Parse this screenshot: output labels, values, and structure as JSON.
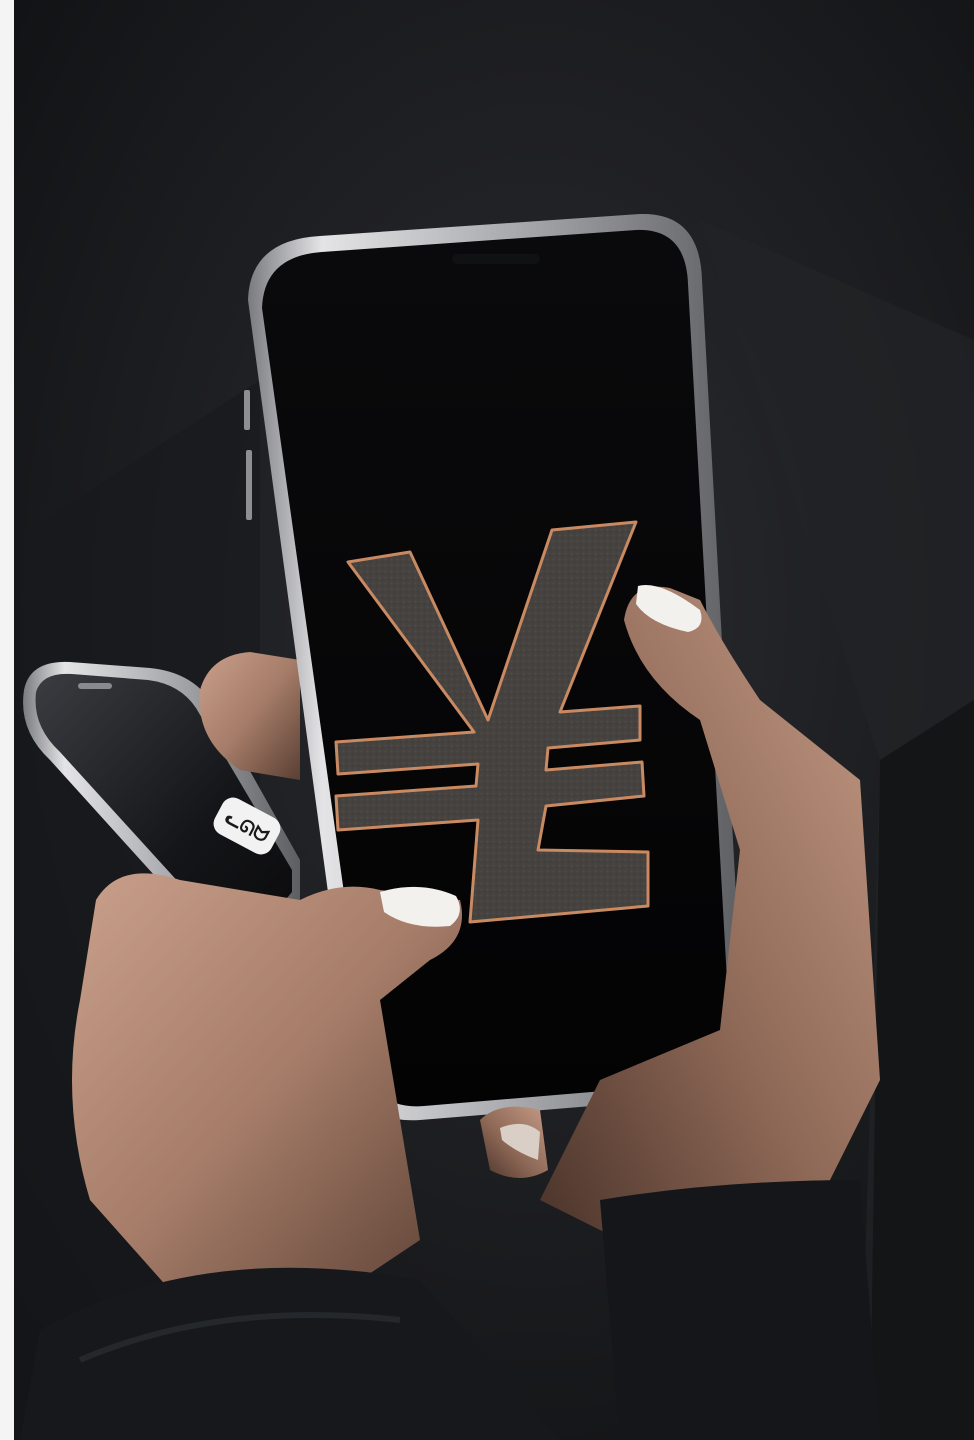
{
  "scene": {
    "subject": "hands-holding-two-smartphones",
    "main_screen_symbol": "yen-sign",
    "side_screen_badge": "ᓚᘏᗢ"
  },
  "colors": {
    "background": "#1a1b1e",
    "background_light": "#2a2b2f",
    "phone_frame": "#c9c9cc",
    "screen": "#050506",
    "symbol_fill": "#46423f",
    "symbol_outline": "#c98a62",
    "skin": "#b88f7a",
    "skin_shadow": "#5b4034",
    "nail": "#f3f1ee",
    "sleeve": "#15171a"
  }
}
